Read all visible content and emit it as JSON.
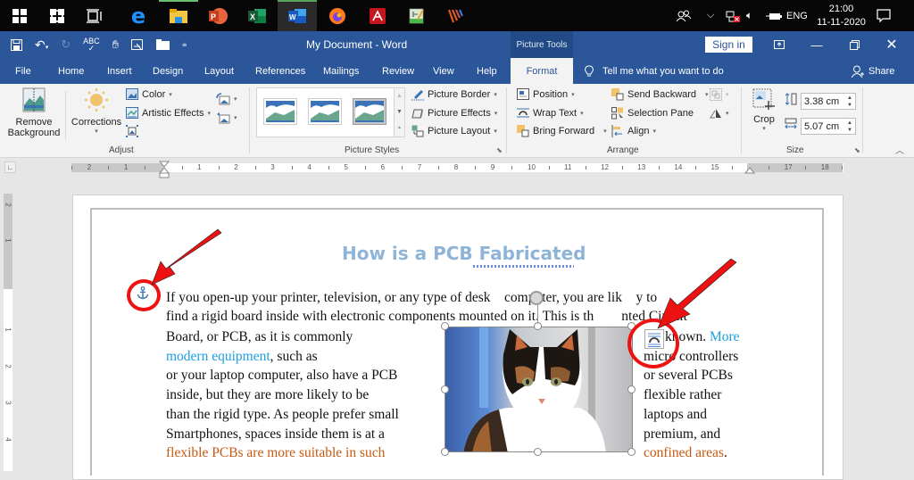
{
  "taskbar": {
    "apps": [
      {
        "name": "windows-start",
        "active": false
      },
      {
        "name": "cortana-search",
        "active": false
      },
      {
        "name": "task-view",
        "active": false
      },
      {
        "name": "edge",
        "active": false
      },
      {
        "name": "file-explorer",
        "active": false,
        "running": true
      },
      {
        "name": "powerpoint",
        "active": false
      },
      {
        "name": "excel",
        "active": false
      },
      {
        "name": "word",
        "active": true,
        "running": true
      },
      {
        "name": "firefox",
        "active": false
      },
      {
        "name": "acrobat",
        "active": false
      },
      {
        "name": "notepad-editor",
        "active": false
      },
      {
        "name": "app-stripes",
        "active": false
      }
    ],
    "tray": {
      "language": "ENG",
      "time": "21:00",
      "date": "11-11-2020"
    }
  },
  "titlebar": {
    "doc_title": "My Document  -  Word",
    "contextual_group": "Picture Tools",
    "sign_in": "Sign in"
  },
  "tabs": [
    {
      "label": "File"
    },
    {
      "label": "Home"
    },
    {
      "label": "Insert"
    },
    {
      "label": "Design"
    },
    {
      "label": "Layout"
    },
    {
      "label": "References"
    },
    {
      "label": "Mailings"
    },
    {
      "label": "Review"
    },
    {
      "label": "View"
    },
    {
      "label": "Help"
    },
    {
      "label": "Format",
      "active": true
    }
  ],
  "tell_me": "Tell me what you want to do",
  "share": "Share",
  "ribbon": {
    "adjust": {
      "label": "Adjust",
      "remove_background": [
        "Remove",
        "Background"
      ],
      "corrections": "Corrections",
      "color": "Color",
      "artistic_effects": "Artistic Effects"
    },
    "picture_styles": {
      "label": "Picture Styles",
      "picture_border": "Picture Border",
      "picture_effects": "Picture Effects",
      "picture_layout": "Picture Layout"
    },
    "arrange": {
      "label": "Arrange",
      "position": "Position",
      "wrap_text": "Wrap Text",
      "bring_forward": "Bring Forward",
      "send_backward": "Send Backward",
      "selection_pane": "Selection Pane",
      "align": "Align"
    },
    "size": {
      "label": "Size",
      "crop": "Crop",
      "height": "3.38 cm",
      "width": "5.07 cm"
    }
  },
  "ruler": {
    "left_numbers": [
      "2",
      "1"
    ],
    "numbers": [
      "1",
      "2",
      "3",
      "4",
      "5",
      "6",
      "7",
      "8",
      "9",
      "10",
      "11",
      "12",
      "13",
      "14",
      "15",
      "17",
      "18"
    ],
    "vertical_numbers": [
      "2",
      "1",
      "1",
      "2",
      "3",
      "4"
    ]
  },
  "document": {
    "heading": "How is a PCB Fabricated",
    "lines": [
      {
        "segments": [
          {
            "text": "If you open-up your printer, television, or any type of desk",
            "style": "normal"
          },
          {
            "text": "    ",
            "style": "normal"
          },
          {
            "text": "computer, you are lik",
            "style": "normal"
          },
          {
            "text": "    ",
            "style": "normal"
          },
          {
            "text": "y to",
            "style": "normal"
          }
        ]
      },
      {
        "segments": [
          {
            "text": "find a rigid board inside with electronic components mounted on it. This is th",
            "style": "normal"
          },
          {
            "text": "        ",
            "style": "normal"
          },
          {
            "text": "nted Circuit",
            "style": "normal"
          }
        ]
      }
    ],
    "left_column": [
      [
        {
          "text": "Board, or PCB, as it is commonly",
          "style": "normal"
        }
      ],
      [
        {
          "text": "modern equipment",
          "style": "blue"
        },
        {
          "text": ", such as",
          "style": "normal"
        }
      ],
      [
        {
          "text": "or your laptop computer, also have a PCB",
          "style": "normal"
        }
      ],
      [
        {
          "text": "inside, but they are more likely to be",
          "style": "normal"
        }
      ],
      [
        {
          "text": "than the rigid type. As people prefer small",
          "style": "normal"
        }
      ],
      [
        {
          "text": "Smartphones, spaces inside them is at a",
          "style": "normal"
        }
      ],
      [
        {
          "text": "flexible PCBs are more suitable in such",
          "style": "orange"
        }
      ]
    ],
    "right_column": [
      [
        {
          "text": "known. ",
          "style": "normal"
        },
        {
          "text": "More",
          "style": "blue"
        }
      ],
      [
        {
          "text": "micro controllers",
          "style": "normal"
        }
      ],
      [
        {
          "text": "or several PCBs",
          "style": "normal"
        }
      ],
      [
        {
          "text": "flexible rather",
          "style": "normal"
        }
      ],
      [
        {
          "text": "laptops and",
          "style": "normal"
        }
      ],
      [
        {
          "text": "premium, and",
          "style": "normal"
        }
      ],
      [
        {
          "text": "confined areas",
          "style": "orange"
        },
        {
          "text": ".",
          "style": "normal"
        }
      ]
    ]
  },
  "colors": {
    "word_blue": "#2b579a",
    "heading": "#8eb4d8",
    "link_blue": "#1ba1e2",
    "orange": "#c55a11",
    "annotation_red": "#ee1111"
  }
}
